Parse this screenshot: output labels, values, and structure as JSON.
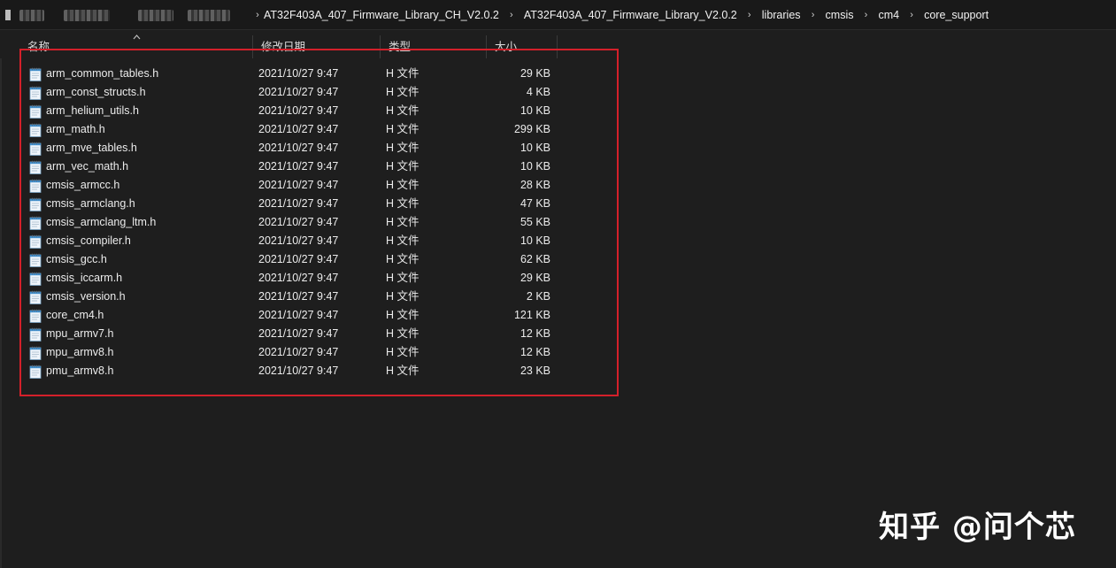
{
  "breadcrumb": {
    "items": [
      "AT32F403A_407_Firmware_Library_CH_V2.0.2",
      "AT32F403A_407_Firmware_Library_V2.0.2",
      "libraries",
      "cmsis",
      "cm4",
      "core_support"
    ],
    "separator": "›"
  },
  "columns": {
    "name": "名称",
    "date": "修改日期",
    "type": "类型",
    "size": "大小"
  },
  "files": [
    {
      "name": "arm_common_tables.h",
      "date": "2021/10/27 9:47",
      "type": "H 文件",
      "size": "29 KB"
    },
    {
      "name": "arm_const_structs.h",
      "date": "2021/10/27 9:47",
      "type": "H 文件",
      "size": "4 KB"
    },
    {
      "name": "arm_helium_utils.h",
      "date": "2021/10/27 9:47",
      "type": "H 文件",
      "size": "10 KB"
    },
    {
      "name": "arm_math.h",
      "date": "2021/10/27 9:47",
      "type": "H 文件",
      "size": "299 KB"
    },
    {
      "name": "arm_mve_tables.h",
      "date": "2021/10/27 9:47",
      "type": "H 文件",
      "size": "10 KB"
    },
    {
      "name": "arm_vec_math.h",
      "date": "2021/10/27 9:47",
      "type": "H 文件",
      "size": "10 KB"
    },
    {
      "name": "cmsis_armcc.h",
      "date": "2021/10/27 9:47",
      "type": "H 文件",
      "size": "28 KB"
    },
    {
      "name": "cmsis_armclang.h",
      "date": "2021/10/27 9:47",
      "type": "H 文件",
      "size": "47 KB"
    },
    {
      "name": "cmsis_armclang_ltm.h",
      "date": "2021/10/27 9:47",
      "type": "H 文件",
      "size": "55 KB"
    },
    {
      "name": "cmsis_compiler.h",
      "date": "2021/10/27 9:47",
      "type": "H 文件",
      "size": "10 KB"
    },
    {
      "name": "cmsis_gcc.h",
      "date": "2021/10/27 9:47",
      "type": "H 文件",
      "size": "62 KB"
    },
    {
      "name": "cmsis_iccarm.h",
      "date": "2021/10/27 9:47",
      "type": "H 文件",
      "size": "29 KB"
    },
    {
      "name": "cmsis_version.h",
      "date": "2021/10/27 9:47",
      "type": "H 文件",
      "size": "2 KB"
    },
    {
      "name": "core_cm4.h",
      "date": "2021/10/27 9:47",
      "type": "H 文件",
      "size": "121 KB"
    },
    {
      "name": "mpu_armv7.h",
      "date": "2021/10/27 9:47",
      "type": "H 文件",
      "size": "12 KB"
    },
    {
      "name": "mpu_armv8.h",
      "date": "2021/10/27 9:47",
      "type": "H 文件",
      "size": "12 KB"
    },
    {
      "name": "pmu_armv8.h",
      "date": "2021/10/27 9:47",
      "type": "H 文件",
      "size": "23 KB"
    }
  ],
  "icons": {
    "file": "header-file-icon",
    "sort": "sort-ascending-icon",
    "separator": "chevron-right-icon"
  },
  "colors": {
    "background": "#1e1e1e",
    "highlight": "#d4202a"
  },
  "watermark": "知乎 @问个芯"
}
